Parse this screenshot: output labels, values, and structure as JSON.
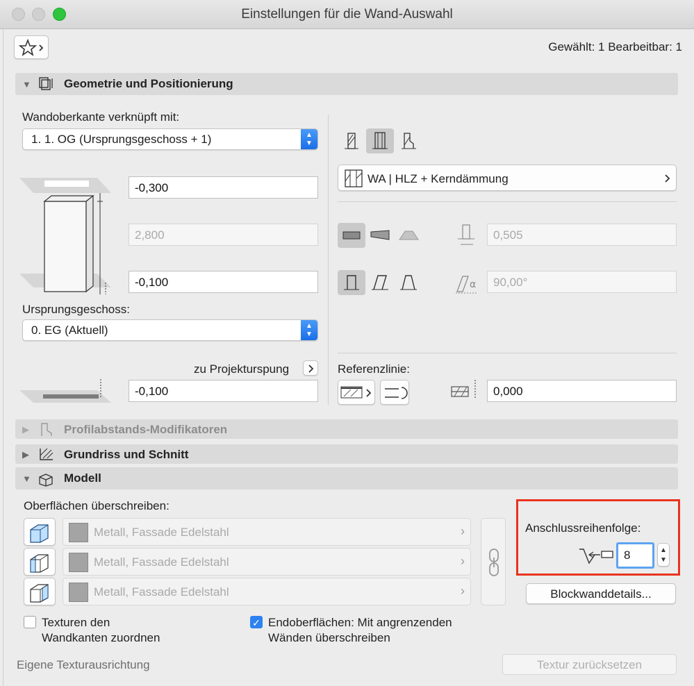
{
  "window": {
    "title": "Einstellungen für die Wand-Auswahl",
    "selection_info": "Gewählt: 1 Bearbeitbar: 1"
  },
  "sections": {
    "geometry": "Geometrie und Positionierung",
    "profile": "Profilabstands-Modifikatoren",
    "floorplan": "Grundriss und Schnitt",
    "model": "Modell"
  },
  "geometry": {
    "top_linked_label": "Wandoberkante verknüpft mit:",
    "top_linked_value": "1. 1. OG (Ursprungsgeschoss + 1)",
    "top_offset": "-0,300",
    "height": "2,800",
    "bottom_offset": "-0,100",
    "home_story_label": "Ursprungsgeschoss:",
    "home_story_value": "0. EG (Aktuell)",
    "project_origin_label": "zu Projekturspung",
    "project_origin_value": "-0,100",
    "composite_label": "WA | HLZ + Kerndämmung",
    "thickness": "0,505",
    "angle": "90,00°",
    "ref_line_label": "Referenzlinie:",
    "ref_offset": "0,000"
  },
  "model": {
    "override_label": "Oberflächen überschreiben:",
    "surfaces": [
      "Metall, Fassade Edelstahl",
      "Metall, Fassade Edelstahl",
      "Metall, Fassade Edelstahl"
    ],
    "connection_order_label": "Anschlussreihenfolge:",
    "connection_order_value": "8",
    "block_details_button": "Blockwanddetails...",
    "texture_checkbox_line1": "Texturen den",
    "texture_checkbox_line2": "Wandkanten zuordnen",
    "end_surfaces_line1": "Endoberflächen: Mit angrenzenden",
    "end_surfaces_line2": "Wänden überschreiben",
    "custom_texture_label": "Eigene Texturausrichtung",
    "reset_texture_button": "Textur zurücksetzen"
  },
  "colors": {
    "highlight_border": "#e8331f",
    "accent": "#2d82f0"
  }
}
